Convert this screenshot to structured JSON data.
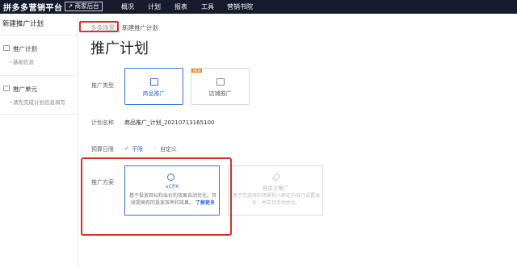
{
  "topbar": {
    "brand": "拼多多营销平台",
    "business_backend": "商家后台",
    "nav": [
      "概况",
      "计划",
      "报表",
      "工具",
      "营销书院"
    ]
  },
  "sidebar": {
    "title": "新建推广计划",
    "sections": [
      {
        "title": "推广计划",
        "sub": "基础信息"
      },
      {
        "title": "推广单元",
        "sub": "请先完成计划信息填写"
      }
    ]
  },
  "breadcrumb": {
    "first": "多多场景",
    "sep": "/",
    "current": "新建推广计划"
  },
  "page_title": "推广计划",
  "form": {
    "promo_type_label": "推广类型",
    "promo_types": [
      {
        "label": "商品推广",
        "icon": "gift-icon",
        "selected": true
      },
      {
        "label": "店铺推广",
        "icon": "store-icon",
        "selected": false,
        "badge": "NEW"
      }
    ],
    "plan_name_label": "计划名称",
    "plan_name_value": "商品推广_计划_20210713165100",
    "budget_label": "预算日限",
    "budget_options": [
      {
        "label": "不限",
        "selected": true,
        "check": "✓"
      },
      {
        "label": "自定义",
        "selected": false,
        "check": "✓"
      }
    ],
    "scheme_label": "推广方案",
    "schemes": [
      {
        "title": "oCPX",
        "desc": "基于投放目标和出价的效果自动优化，持续提高你的投放效率和效果。",
        "link": "了解更多",
        "selected": true
      },
      {
        "title": "自定义推广",
        "desc": "基于您选择的场景和人群定向自行设置出价，并支持手动优化。",
        "selected": false
      }
    ]
  },
  "colors": {
    "accent": "#3b6de0",
    "highlight": "#d6322c",
    "topbar": "#161b2e"
  }
}
